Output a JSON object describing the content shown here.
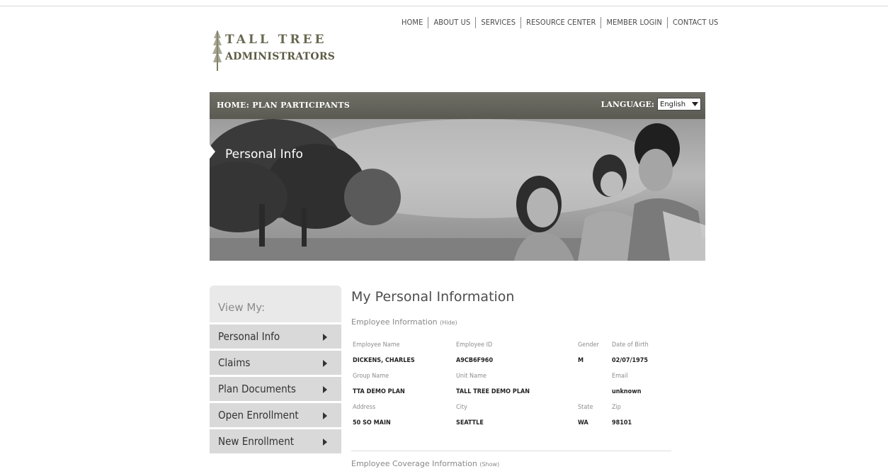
{
  "top_nav": [
    "HOME",
    "ABOUT US",
    "SERVICES",
    "RESOURCE CENTER",
    "MEMBER LOGIN",
    "CONTACT US"
  ],
  "logo": {
    "line1": "TALL TREE",
    "line2": "ADMINISTRATORS"
  },
  "header_bar": {
    "breadcrumb": "HOME: PLAN PARTICIPANTS",
    "language_label": "LANGUAGE:",
    "language_selected": "English"
  },
  "hero": {
    "title": "Personal Info"
  },
  "sidebar": {
    "heading": "View My:",
    "items": [
      {
        "label": "Personal Info"
      },
      {
        "label": "Claims"
      },
      {
        "label": "Plan Documents"
      },
      {
        "label": "Open Enrollment"
      },
      {
        "label": "New Enrollment"
      }
    ]
  },
  "main": {
    "title": "My Personal Information",
    "employee_section": {
      "title": "Employee Information",
      "toggle": "(Hide)"
    },
    "fields": {
      "employee_name_label": "Employee Name",
      "employee_name": "DICKENS, CHARLES",
      "employee_id_label": "Employee ID",
      "employee_id": "A9CB6F960",
      "gender_label": "Gender",
      "gender": "M",
      "dob_label": "Date of Birth",
      "dob": "02/07/1975",
      "group_name_label": "Group Name",
      "group_name": "TTA DEMO PLAN",
      "unit_name_label": "Unit Name",
      "unit_name": "TALL TREE DEMO PLAN",
      "email_label": "Email",
      "email": "unknown",
      "address_label": "Address",
      "address": "50 SO MAIN",
      "city_label": "City",
      "city": "SEATTLE",
      "state_label": "State",
      "state": "WA",
      "zip_label": "Zip",
      "zip": "98101"
    },
    "coverage_section": {
      "title": "Employee Coverage Information",
      "toggle": "(Show)"
    }
  },
  "colors": {
    "band": "#5e5e56",
    "sidebar_item": "#d9d9d9",
    "sidebar_head": "#e9e9e9"
  }
}
